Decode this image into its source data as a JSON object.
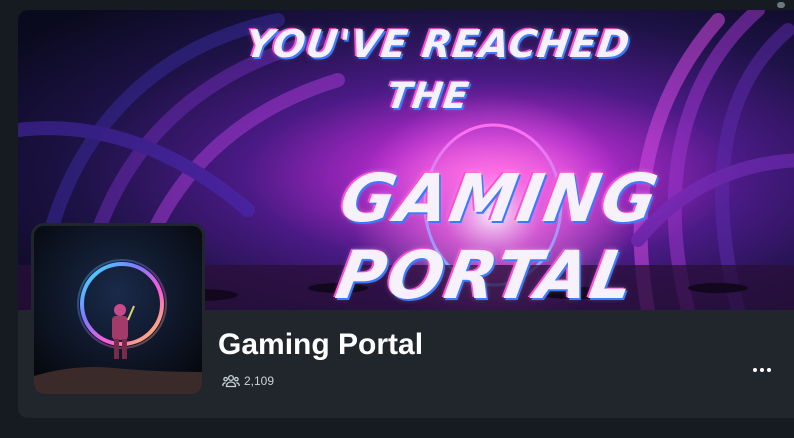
{
  "group": {
    "banner_text_line1": "YOU'VE REACHED",
    "banner_text_line2": "THE",
    "banner_text_line3": "GAMING PORTAL",
    "title": "Gaming Portal",
    "member_count": "2,109",
    "members_icon": "people-icon",
    "more_icon": "more-horizontal-icon"
  },
  "colors": {
    "background": "#161b22",
    "card": "#21262d",
    "accent_pink": "#ff4fd8",
    "accent_blue": "#3b7bff"
  }
}
